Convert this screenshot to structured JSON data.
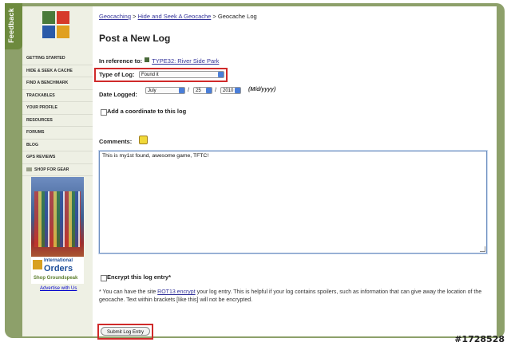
{
  "feedback_tab": "Feedback",
  "sidebar": {
    "items": [
      {
        "label": "GETTING STARTED"
      },
      {
        "label": "HIDE & SEEK A CACHE"
      },
      {
        "label": "FIND A BENCHMARK"
      },
      {
        "label": "TRACKABLES"
      },
      {
        "label": "YOUR PROFILE"
      },
      {
        "label": "RESOURCES"
      },
      {
        "label": "FORUMS"
      },
      {
        "label": "BLOG"
      },
      {
        "label": "GPS REVIEWS"
      },
      {
        "label": "SHOP FOR GEAR"
      }
    ],
    "ad": {
      "line1": "International",
      "line2": "Orders",
      "line3": "Shop Groundspeak"
    },
    "advertise_link": "Advertise with Us"
  },
  "breadcrumb": {
    "items": [
      "Geocaching",
      "Hide and Seek A Geocache",
      "Geocache Log"
    ],
    "separator": " > "
  },
  "page_title": "Post a New Log",
  "reference": {
    "label": "In reference to:",
    "link": "TYPE32: River Side Park"
  },
  "log_type": {
    "label": "Type of Log:",
    "value": "Found it"
  },
  "date_logged": {
    "label": "Date Logged:",
    "month": "July",
    "day": "25",
    "year": "2010",
    "format_hint": "(M/d/yyyy)"
  },
  "coordinate": {
    "label": "Add a coordinate to this log"
  },
  "comments": {
    "label": "Comments:",
    "value": "This is my1st found, awesome game, TFTC!"
  },
  "encrypt": {
    "label": "Encrypt this log entry*"
  },
  "encrypt_note": {
    "before": "* You can have the site ",
    "link": "ROT13 encrypt",
    "after": " your log entry. This is helpful if your log contains spoilers, such as information that can give away the location of the geocache. Text within brackets [like this] will not be encrypted."
  },
  "submit_label": "Submit Log Entry",
  "watermark": "#1728528",
  "colors": {
    "frame": "#8da06a",
    "highlight": "#d02a2a",
    "link": "#333399",
    "sidebar": "#eef0e4"
  }
}
